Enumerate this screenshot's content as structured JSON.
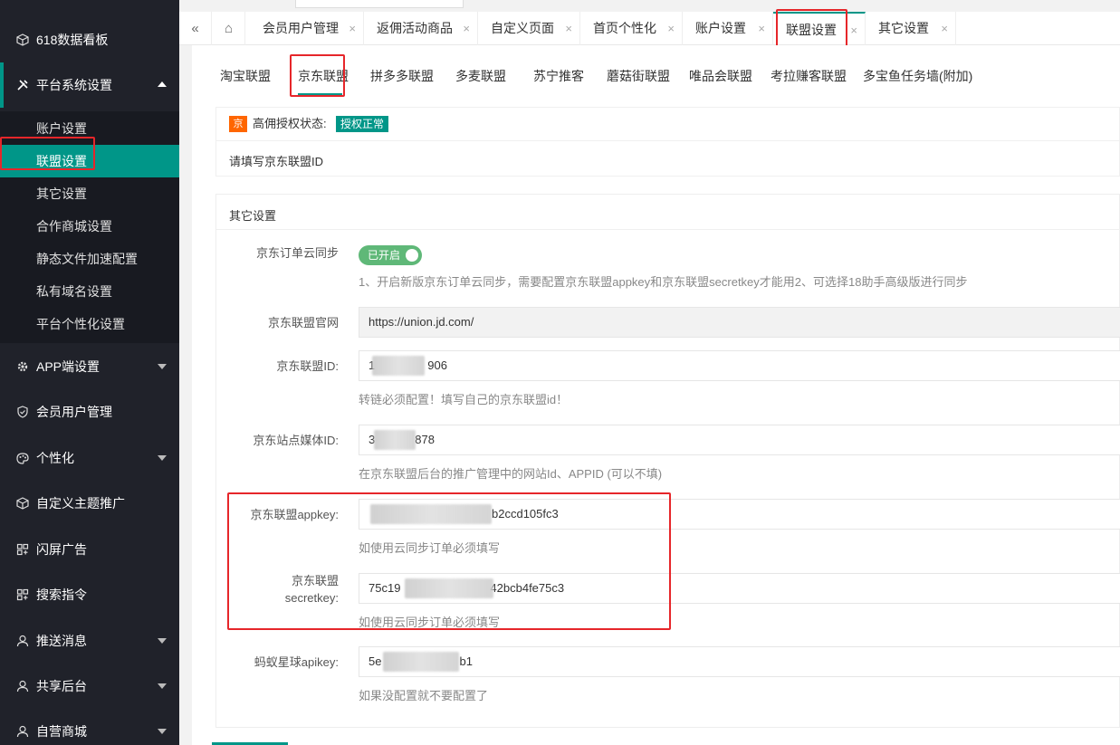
{
  "sidebar": {
    "items": [
      {
        "label": "618数据看板",
        "icon": "cube-icon"
      },
      {
        "label": "平台系统设置",
        "icon": "tools-icon"
      },
      {
        "label": "APP端设置",
        "icon": "gear-icon"
      },
      {
        "label": "会员用户管理",
        "icon": "shield-icon"
      },
      {
        "label": "个性化",
        "icon": "palette-icon"
      },
      {
        "label": "自定义主题推广",
        "icon": "cube-icon"
      },
      {
        "label": "闪屏广告",
        "icon": "grid-icon"
      },
      {
        "label": "搜索指令",
        "icon": "grid-icon"
      },
      {
        "label": "推送消息",
        "icon": "user-icon"
      },
      {
        "label": "共享后台",
        "icon": "user-icon"
      },
      {
        "label": "自营商城",
        "icon": "user-icon"
      }
    ],
    "submenu": [
      "账户设置",
      "联盟设置",
      "其它设置",
      "合作商城设置",
      "静态文件加速配置",
      "私有域名设置",
      "平台个性化设置"
    ]
  },
  "topbar": {
    "collapse_glyph": "«",
    "home_glyph": "⌂",
    "close_glyph": "×",
    "tabs": [
      "会员用户管理",
      "返佣活动商品",
      "自定义页面",
      "首页个性化",
      "账户设置",
      "联盟设置",
      "其它设置"
    ]
  },
  "subtabs": [
    "淘宝联盟",
    "京东联盟",
    "拼多多联盟",
    "多麦联盟",
    "苏宁推客",
    "蘑菇街联盟",
    "唯品会联盟",
    "考拉赚客联盟",
    "多宝鱼任务墙(附加)"
  ],
  "auth": {
    "badge": "京",
    "label": "高佣授权状态:",
    "status": "授权正常",
    "hint": "请填写京东联盟ID"
  },
  "other_settings": {
    "title": "其它设置",
    "sync": {
      "label": "京东订单云同步",
      "switch_text": "已开启",
      "hint": "1、开启新版京东订单云同步，需要配置京东联盟appkey和京东联盟secretkey才能用2、可选择18助手高级版进行同步"
    },
    "official_site": {
      "label": "京东联盟官网",
      "value": "https://union.jd.com/"
    },
    "union_id": {
      "label": "京东联盟ID:",
      "value_start": "1",
      "value_end": "906",
      "hint": "转链必须配置！填写自己的京东联盟id！"
    },
    "media_id": {
      "label": "京东站点媒体ID:",
      "value_start": "3",
      "value_end": "878",
      "hint": "在京东联盟后台的推广管理中的网站Id、APPID (可以不填)"
    },
    "appkey": {
      "label": "京东联盟appkey:",
      "value_end": "b2ccd105fc3",
      "hint": "如使用云同步订单必须填写"
    },
    "secretkey": {
      "label_line1": "京东联盟",
      "label_line2": "secretkey:",
      "value_start": "75c19",
      "value_end": "42bcb4fe75c3",
      "hint": "如使用云同步订单必须填写"
    },
    "apikey": {
      "label": "蚂蚁星球apikey:",
      "value_start": "5e",
      "value_end": "b1",
      "hint": "如果没配置就不要配置了"
    }
  }
}
